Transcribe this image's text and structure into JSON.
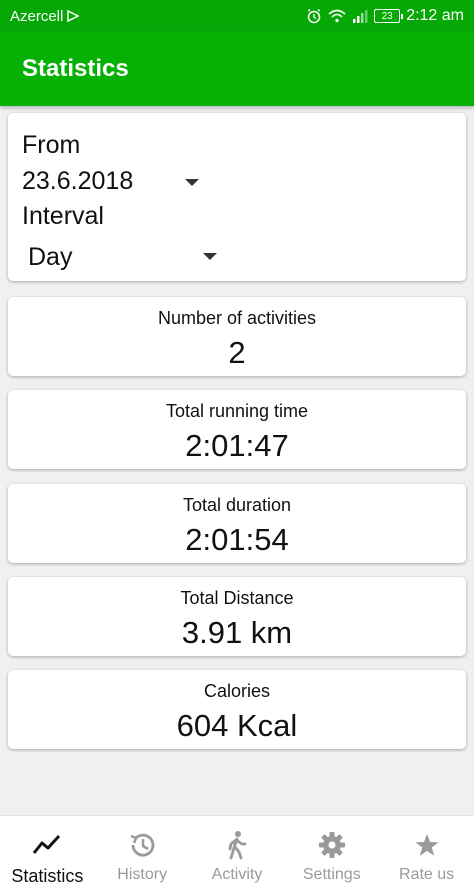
{
  "status_bar": {
    "carrier": "Azercell",
    "battery": "23",
    "time": "2:12 am"
  },
  "app_bar": {
    "title": "Statistics"
  },
  "filters": {
    "from_label": "From",
    "from_value": "23.6.2018",
    "interval_label": "Interval",
    "interval_value": "Day"
  },
  "stats": [
    {
      "title": "Number of activities",
      "value": "2"
    },
    {
      "title": "Total running time",
      "value": "2:01:47"
    },
    {
      "title": "Total duration",
      "value": "2:01:54"
    },
    {
      "title": "Total Distance",
      "value": "3.91  km"
    },
    {
      "title": "Calories",
      "value": "604  Kcal"
    }
  ],
  "bottom_nav": [
    {
      "label": "Statistics",
      "icon": "chart-line-icon",
      "active": true
    },
    {
      "label": "History",
      "icon": "history-icon",
      "active": false
    },
    {
      "label": "Activity",
      "icon": "walking-icon",
      "active": false
    },
    {
      "label": "Settings",
      "icon": "gear-icon",
      "active": false
    },
    {
      "label": "Rate us",
      "icon": "star-icon",
      "active": false
    }
  ],
  "colors": {
    "status_bar": "#06a806",
    "app_bar": "#06b106",
    "background": "#f0f0f0",
    "nav_active": "#111111",
    "nav_inactive": "#9a9a9a"
  }
}
